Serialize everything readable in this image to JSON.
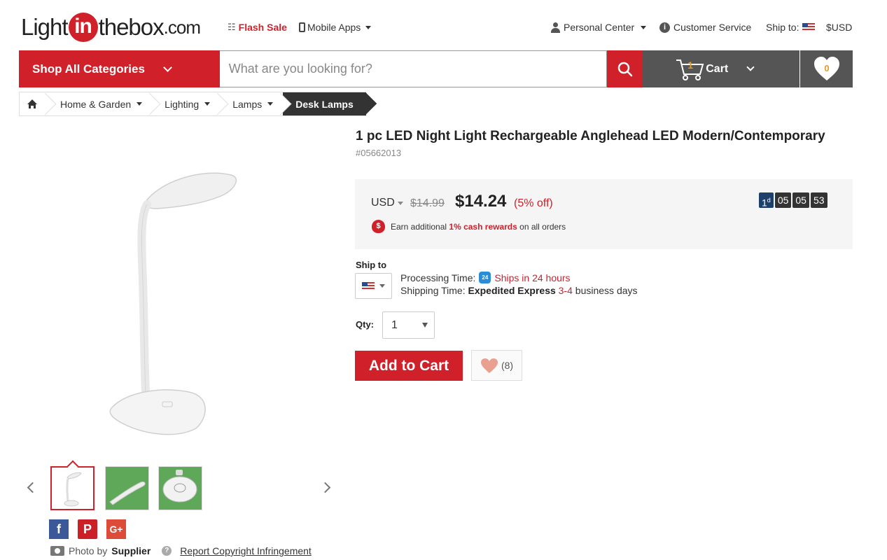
{
  "header": {
    "logo_light": "Light",
    "logo_in": "in",
    "logo_thebox": "thebox",
    "logo_com": ".com",
    "flash_sale": "Flash Sale",
    "mobile_apps": "Mobile Apps",
    "personal_center": "Personal Center",
    "customer_service": "Customer Service",
    "ship_to": "Ship to:",
    "currency": "$USD"
  },
  "nav": {
    "shop_all": "Shop All Categories",
    "search_placeholder": "What are you looking for?",
    "cart_count": "1",
    "cart_label": "Cart",
    "wishlist_count": "0"
  },
  "breadcrumb": {
    "items": [
      "Home & Garden",
      "Lighting",
      "Lamps"
    ],
    "current": "Desk Lamps"
  },
  "product": {
    "title": "1 pc LED Night Light Rechargeable Anglehead LED Modern/Contemporary",
    "sku": "#05662013",
    "currency": "USD",
    "old_price": "$14.99",
    "new_price": "$14.24",
    "discount": "(5% off)",
    "rewards_prefix": "Earn additional",
    "rewards_highlight": "1% cash rewards",
    "rewards_suffix": "on all orders",
    "timer": {
      "days": "1",
      "day_unit": "d",
      "hours": "05",
      "minutes": "05",
      "seconds": "53"
    }
  },
  "shipping": {
    "ship_to_label": "Ship to",
    "processing_label": "Processing Time:",
    "processing_icon_text": "24",
    "processing_value": "Ships in 24 hours",
    "shipping_label": "Shipping Time:",
    "shipping_method": "Expedited Express",
    "shipping_days": "3-4",
    "shipping_suffix": "business days"
  },
  "purchase": {
    "qty_label": "Qty:",
    "qty_value": "1",
    "add_to_cart": "Add to Cart",
    "fav_count": "(8)"
  },
  "footer": {
    "photo_by": "Photo by",
    "supplier": "Supplier",
    "report": "Report Copyright Infringement"
  },
  "colors": {
    "brand_red": "#d0212b",
    "dark_gray": "#555555",
    "timer_blue": "#1d3f6b"
  }
}
